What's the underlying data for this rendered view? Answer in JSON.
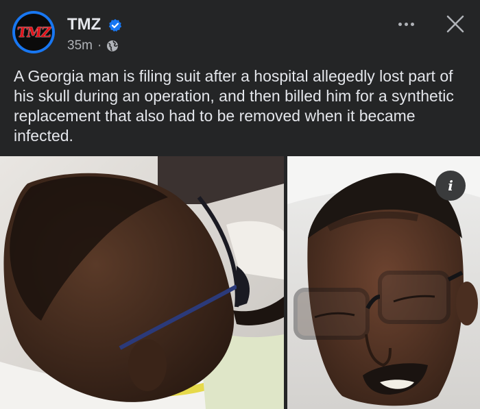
{
  "post": {
    "page_name": "TMZ",
    "avatar_logo_text": "TMZ",
    "timestamp": "35m",
    "separator": "·",
    "audience_icon": "globe-icon",
    "verified_icon": "verified-badge-icon",
    "more_icon": "more-options-icon",
    "close_icon": "close-icon",
    "caption": "A Georgia man is filing suit after a hospital allegedly lost part of his skull during an operation, and then billed him for a synthetic replacement that also had to be removed when it became infected.",
    "info_label": "i",
    "info_icon": "info-icon",
    "photos": [
      {
        "subject": "left-photo"
      },
      {
        "subject": "right-photo"
      }
    ]
  },
  "colors": {
    "background": "#242526",
    "primary_text": "#e4e6eb",
    "secondary_text": "#b0b3b8",
    "verified_blue": "#1877f2",
    "tmz_red": "#e0121a"
  }
}
